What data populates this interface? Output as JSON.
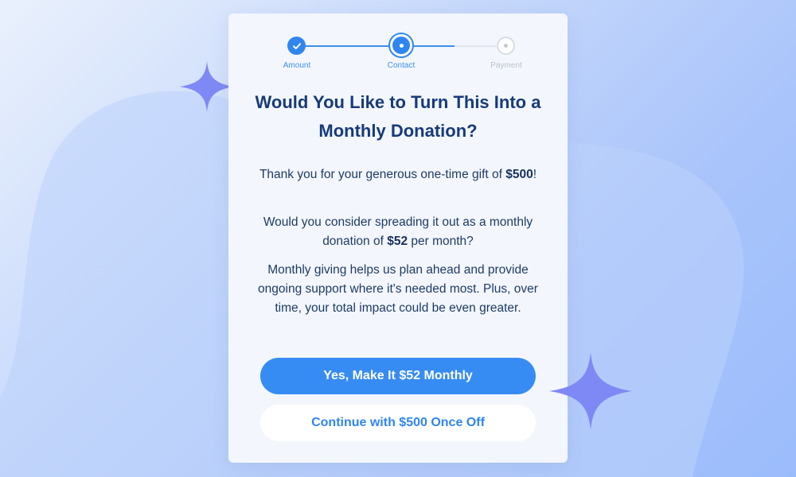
{
  "colors": {
    "accent": "#368cf3",
    "title": "#173a7a",
    "body_text": "#1e3a66",
    "sparkle": "#7f89f5",
    "inactive_step": "#b9bfc9"
  },
  "stepper": {
    "steps": [
      {
        "label": "Amount",
        "state": "completed",
        "icon": "check-icon"
      },
      {
        "label": "Contact",
        "state": "active",
        "icon": "dot-icon"
      },
      {
        "label": "Payment",
        "state": "upcoming",
        "icon": "dot-icon"
      }
    ]
  },
  "dialog": {
    "title": "Would You Like to Turn This Into a Monthly Donation?",
    "para1": {
      "prefix": "Thank you for your generous one-time gift of ",
      "amount": "$500",
      "suffix": "!"
    },
    "para2": {
      "prefix": "Would you consider spreading it out as a monthly donation of ",
      "amount": "$52",
      "suffix": " per month?"
    },
    "para3": "Monthly giving helps us plan ahead and provide ongoing support where it's needed most. Plus, over time, your total impact could be even greater."
  },
  "buttons": {
    "primary_label": "Yes, Make It $52 Monthly",
    "secondary_label": "Continue with $500 Once Off"
  },
  "decorations": {
    "sparkle_icon": "four-point-star-icon"
  }
}
